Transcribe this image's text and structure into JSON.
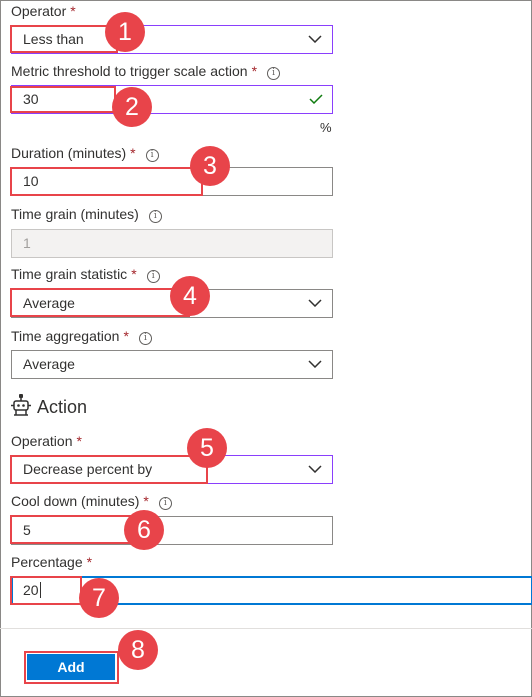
{
  "form": {
    "operator": {
      "label": "Operator",
      "required_mark": "*",
      "value": "Less than"
    },
    "threshold": {
      "label": "Metric threshold to trigger scale action",
      "required_mark": "*",
      "value": "30",
      "unit": "%"
    },
    "duration": {
      "label": "Duration (minutes)",
      "required_mark": "*",
      "value": "10"
    },
    "time_grain": {
      "label": "Time grain (minutes)",
      "value": "1"
    },
    "time_grain_statistic": {
      "label": "Time grain statistic",
      "required_mark": "*",
      "value": "Average"
    },
    "time_aggregation": {
      "label": "Time aggregation",
      "required_mark": "*",
      "value": "Average"
    }
  },
  "action": {
    "title": "Action",
    "operation": {
      "label": "Operation",
      "required_mark": "*",
      "value": "Decrease percent by"
    },
    "cool_down": {
      "label": "Cool down (minutes)",
      "required_mark": "*",
      "value": "5"
    },
    "percentage": {
      "label": "Percentage",
      "required_mark": "*",
      "value": "20"
    }
  },
  "footer": {
    "add_label": "Add"
  },
  "info_glyph": "i",
  "callouts": [
    "1",
    "2",
    "3",
    "4",
    "5",
    "6",
    "7",
    "8"
  ],
  "colors": {
    "accent": "#0078d4",
    "required": "#a4262c",
    "callout": "#e8444a",
    "valid_check": "#107c10",
    "focus_purple": "#8a3ffc"
  },
  "icons": {
    "info": "info-icon",
    "chevron": "chevron-down-icon",
    "check": "checkmark-icon",
    "action": "robot-icon"
  }
}
